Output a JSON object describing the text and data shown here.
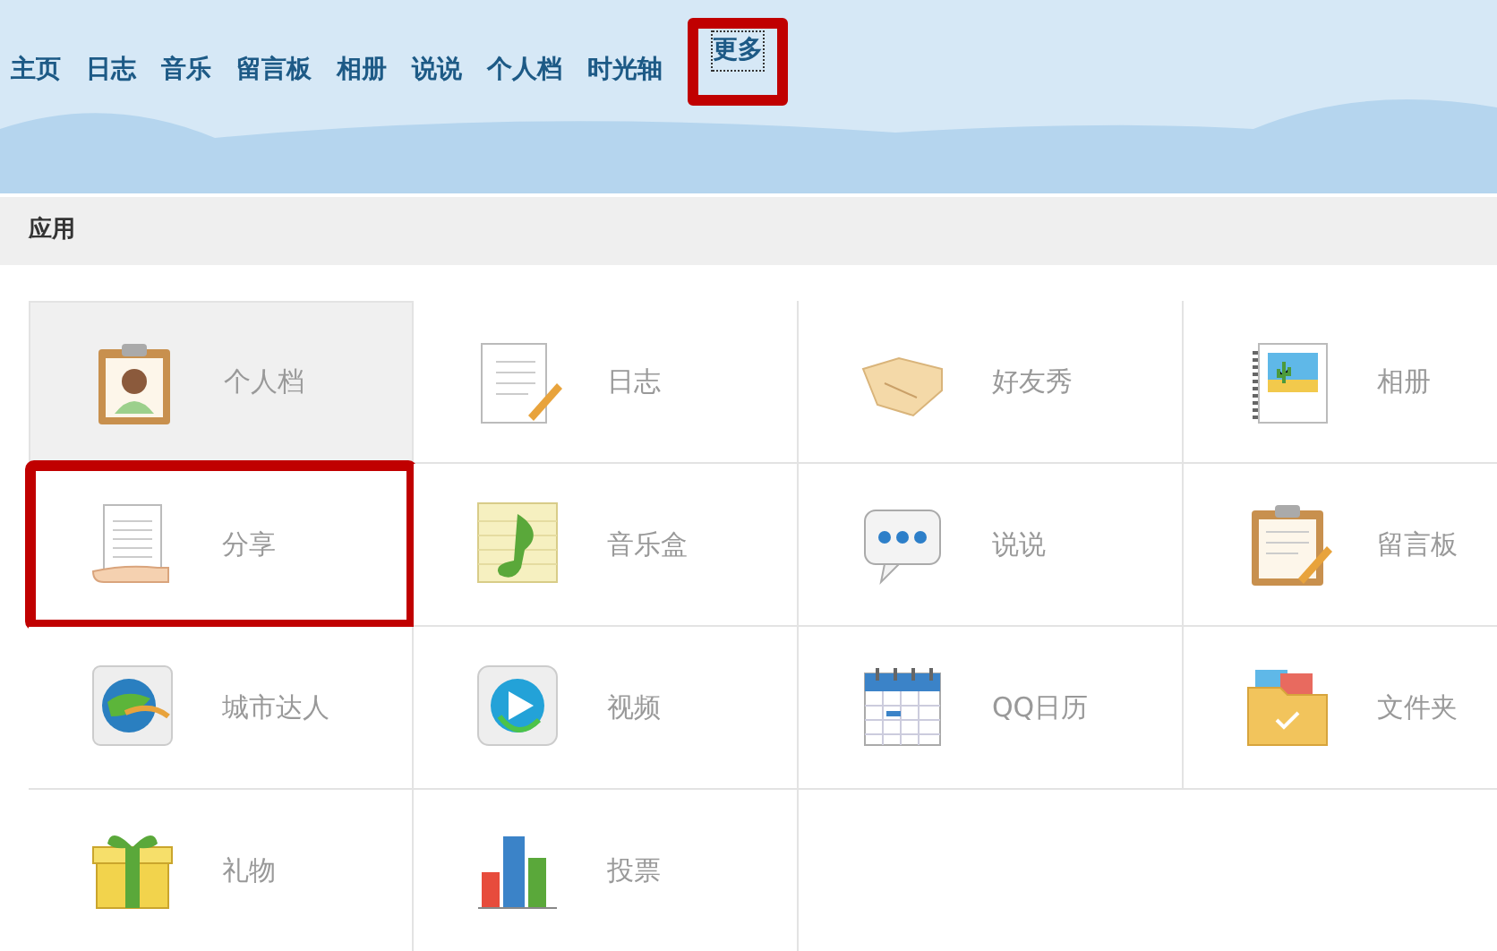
{
  "nav": [
    {
      "label": "主页",
      "highlighted": false
    },
    {
      "label": "日志",
      "highlighted": false
    },
    {
      "label": "音乐",
      "highlighted": false
    },
    {
      "label": "留言板",
      "highlighted": false
    },
    {
      "label": "相册",
      "highlighted": false
    },
    {
      "label": "说说",
      "highlighted": false
    },
    {
      "label": "个人档",
      "highlighted": false
    },
    {
      "label": "时光轴",
      "highlighted": false
    },
    {
      "label": "更多",
      "highlighted": true
    }
  ],
  "section": {
    "title": "应用"
  },
  "apps": [
    {
      "label": "个人档",
      "selected": true,
      "highlighted": false
    },
    {
      "label": "日志",
      "selected": false,
      "highlighted": false
    },
    {
      "label": "好友秀",
      "selected": false,
      "highlighted": false
    },
    {
      "label": "相册",
      "selected": false,
      "highlighted": false
    },
    {
      "label": "分享",
      "selected": false,
      "highlighted": true
    },
    {
      "label": "音乐盒",
      "selected": false,
      "highlighted": false
    },
    {
      "label": "说说",
      "selected": false,
      "highlighted": false
    },
    {
      "label": "留言板",
      "selected": false,
      "highlighted": false
    },
    {
      "label": "城市达人",
      "selected": false,
      "highlighted": false
    },
    {
      "label": "视频",
      "selected": false,
      "highlighted": false
    },
    {
      "label": "QQ日历",
      "selected": false,
      "highlighted": false
    },
    {
      "label": "文件夹",
      "selected": false,
      "highlighted": false
    },
    {
      "label": "礼物",
      "selected": false,
      "highlighted": false
    },
    {
      "label": "投票",
      "selected": false,
      "highlighted": false
    }
  ]
}
